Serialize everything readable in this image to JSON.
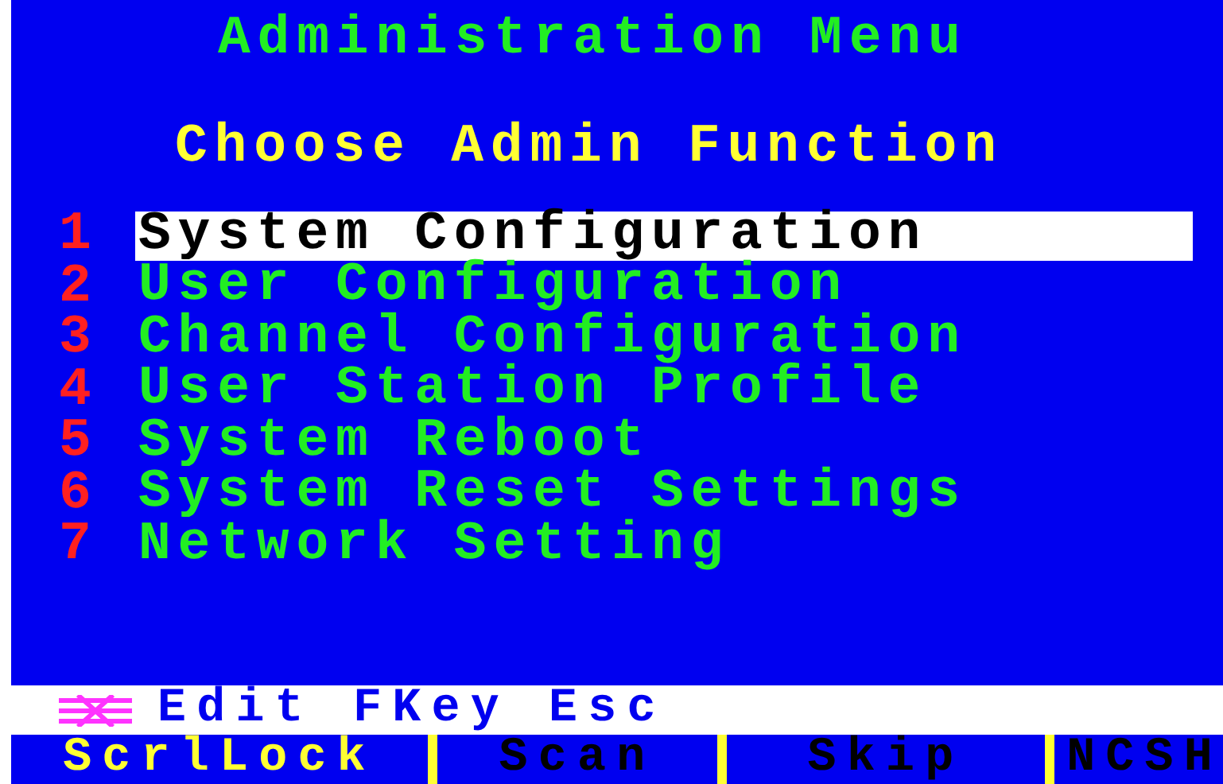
{
  "title": "Administration Menu",
  "subtitle": "Choose Admin Function",
  "menu": [
    {
      "number": "1",
      "label": "System Configuration",
      "selected": true
    },
    {
      "number": "2",
      "label": "User Configuration",
      "selected": false
    },
    {
      "number": "3",
      "label": "Channel Configuration",
      "selected": false
    },
    {
      "number": "4",
      "label": "User Station Profile",
      "selected": false
    },
    {
      "number": "5",
      "label": "System Reboot",
      "selected": false
    },
    {
      "number": "6",
      "label": "System Reset Settings",
      "selected": false
    },
    {
      "number": "7",
      "label": "Network Setting",
      "selected": false
    }
  ],
  "help_bar": {
    "text": "Edit FKey Esc"
  },
  "status_bar": [
    {
      "label": "ScrlLock",
      "active": true
    },
    {
      "label": "Scan",
      "active": false
    },
    {
      "label": "Skip",
      "active": false
    },
    {
      "label": "NCSH",
      "active": false
    }
  ]
}
